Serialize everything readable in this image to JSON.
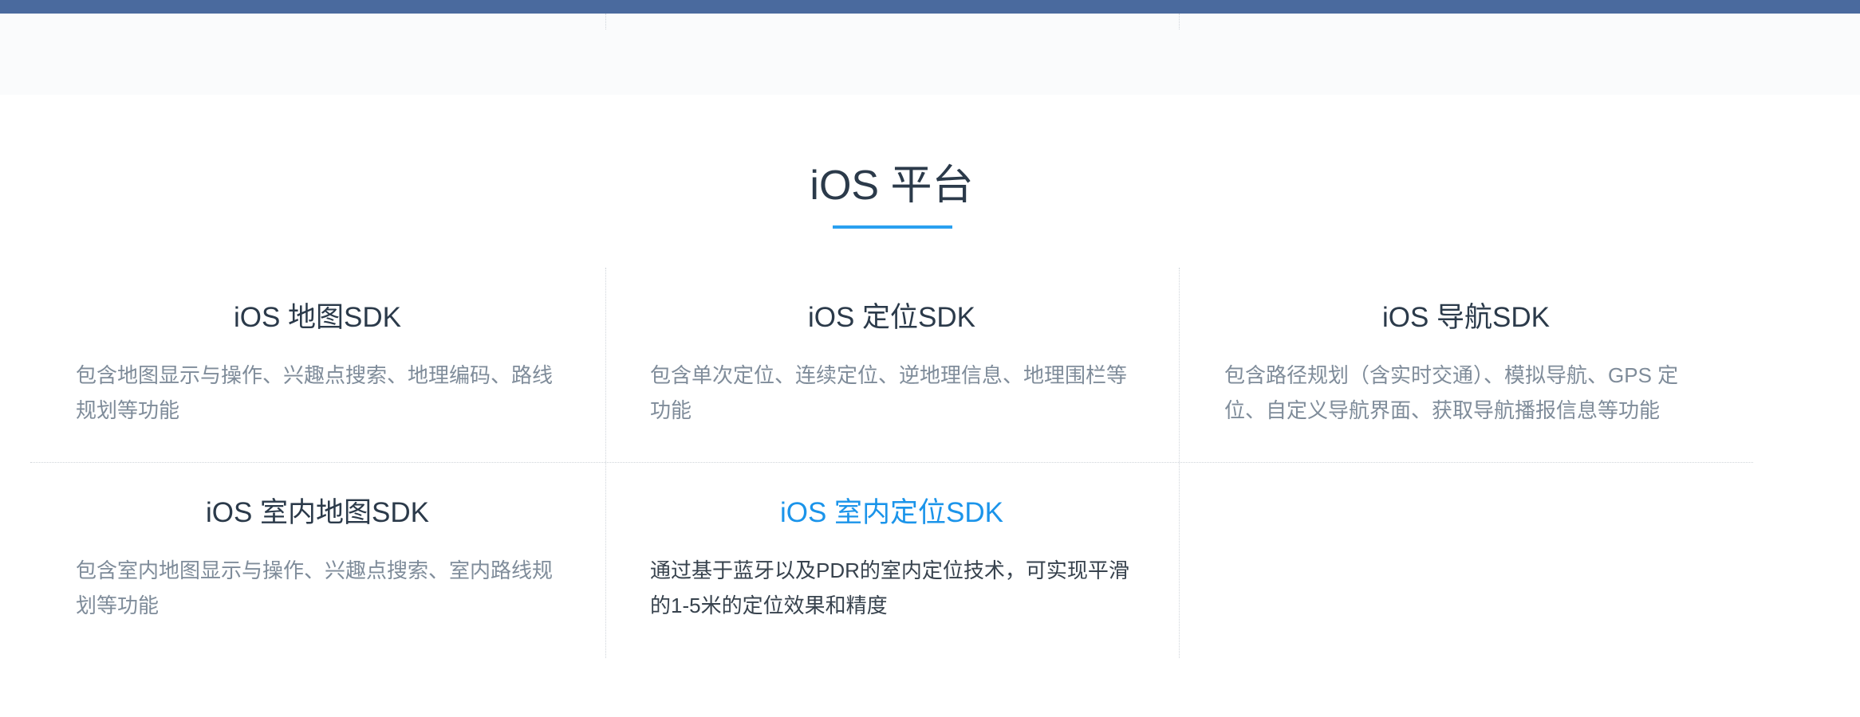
{
  "section": {
    "title": "iOS 平台"
  },
  "cards": [
    {
      "title": "iOS 地图SDK",
      "description": "包含地图显示与操作、兴趣点搜索、地理编码、路线规划等功能"
    },
    {
      "title": "iOS 定位SDK",
      "description": "包含单次定位、连续定位、逆地理信息、地理围栏等功能"
    },
    {
      "title": "iOS 导航SDK",
      "description": "包含路径规划（含实时交通）、模拟导航、GPS 定位、自定义导航界面、获取导航播报信息等功能"
    },
    {
      "title": "iOS 室内地图SDK",
      "description": "包含室内地图显示与操作、兴趣点搜索、室内路线规划等功能"
    },
    {
      "title": "iOS 室内定位SDK",
      "description": "通过基于蓝牙以及PDR的室内定位技术，可实现平滑的1-5米的定位效果和精度",
      "state": "hovered"
    }
  ],
  "colors": {
    "top_bar": "#4a6a9e",
    "accent": "#1b94ea",
    "underline": "#2aa0f0",
    "title_text": "#2b3a4a",
    "desc_text": "#7f8c9a"
  }
}
